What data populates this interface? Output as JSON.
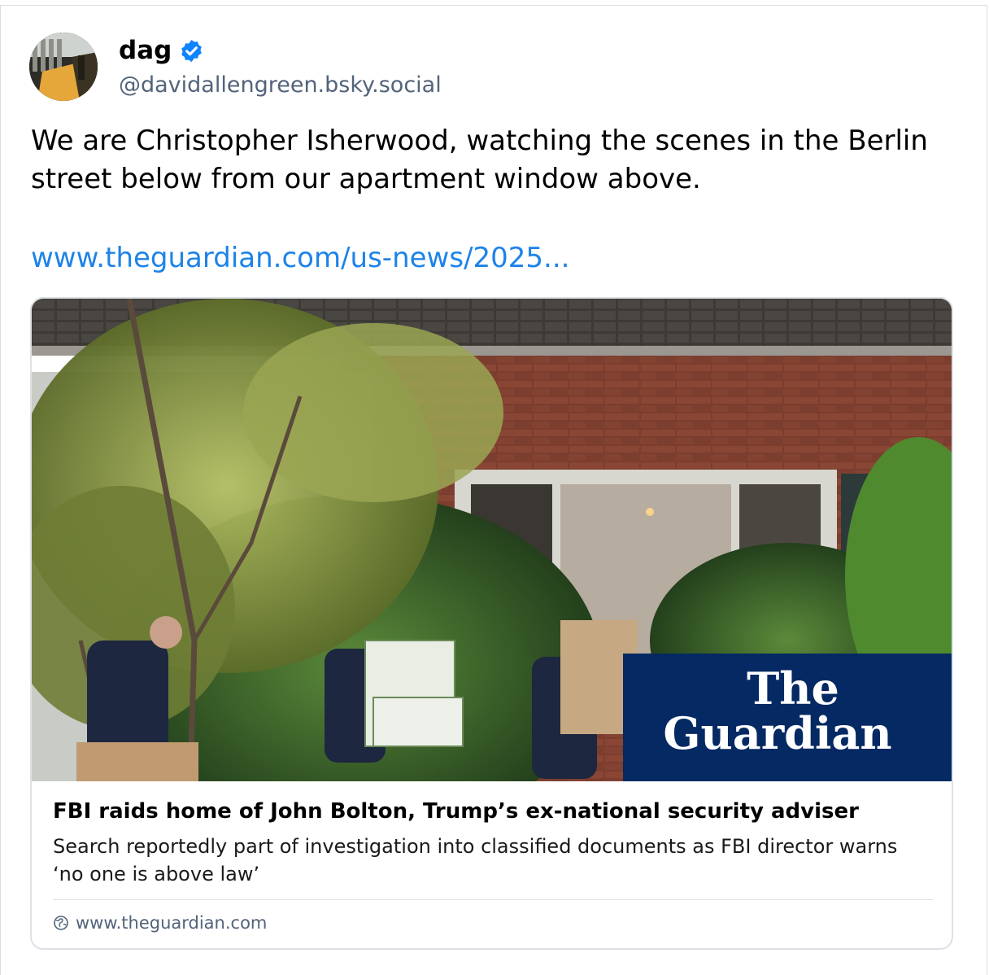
{
  "author": {
    "display_name": "dag",
    "handle": "@davidallengreen.bsky.social",
    "verified": true,
    "badge_color": "#1083fe"
  },
  "post": {
    "text": "We are Christopher Isherwood, watching the scenes in the Berlin street below from our apartment window above.",
    "link_text": "www.theguardian.com/us-news/2025..."
  },
  "link_card": {
    "image_logo_line1": "The",
    "image_logo_line2": "Guardian",
    "title": "FBI raids home of John Bolton, Trump’s ex-national security adviser",
    "description": "Search reportedly part of investigation into classified documents as FBI director warns ‘no one is above law’",
    "domain": "www.theguardian.com",
    "domain_icon": "globe-icon"
  },
  "colors": {
    "link": "#1d83e8",
    "muted_text": "#52637a",
    "guardian_blue": "#052962"
  }
}
